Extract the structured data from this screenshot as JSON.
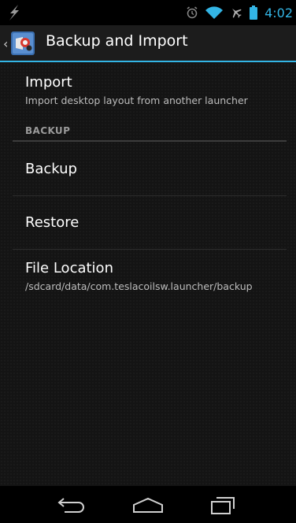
{
  "status_bar": {
    "time": "4:02",
    "icons": [
      "charging-bolt-icon",
      "alarm-icon",
      "wifi-icon",
      "airplane-icon",
      "battery-icon"
    ]
  },
  "action_bar": {
    "title": "Backup and Import",
    "accent_color": "#33b5e5"
  },
  "preferences": {
    "import": {
      "title": "Import",
      "summary": "Import desktop layout from another launcher"
    },
    "backup_category": "BACKUP",
    "backup": {
      "title": "Backup"
    },
    "restore": {
      "title": "Restore"
    },
    "file_location": {
      "title": "File Location",
      "summary": "/sdcard/data/com.teslacoilsw.launcher/backup"
    }
  },
  "nav_bar": {
    "buttons": [
      "back-icon",
      "home-icon",
      "recents-icon"
    ]
  }
}
